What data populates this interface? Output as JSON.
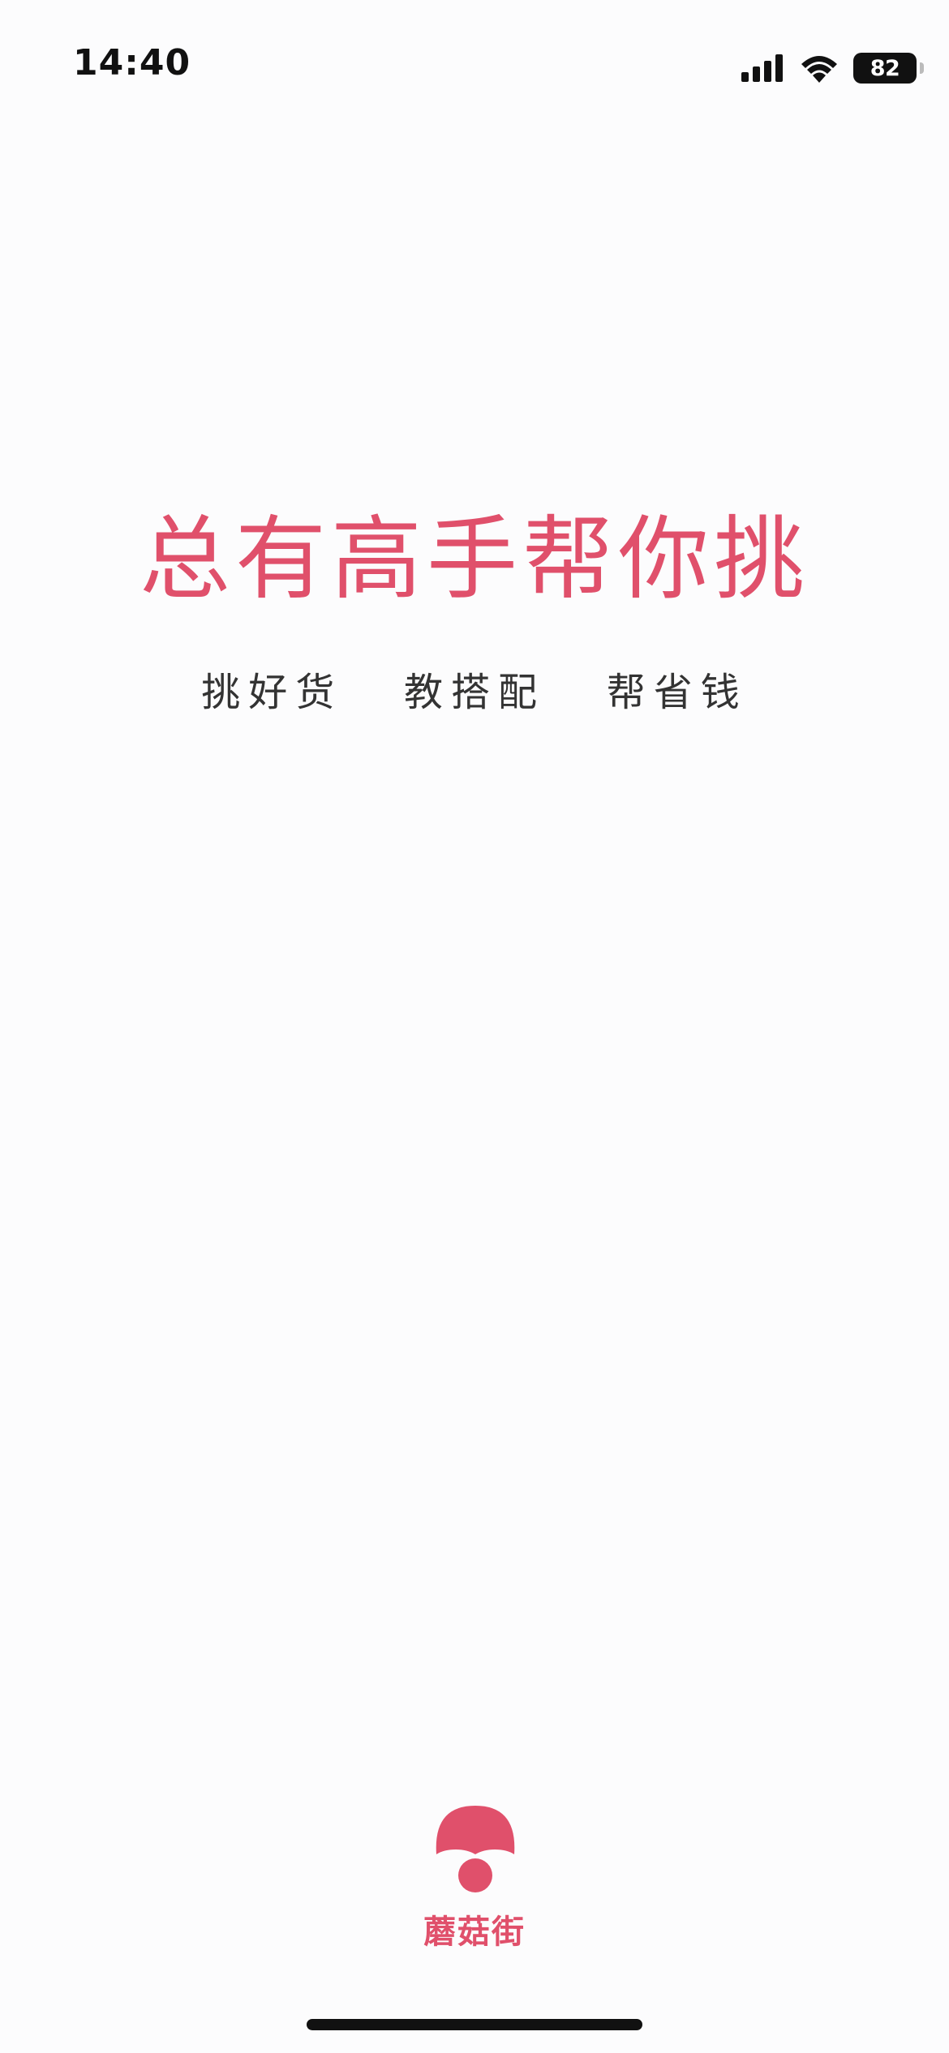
{
  "status_bar": {
    "time": "14:40",
    "battery_level": "82",
    "icons": [
      "cellular-signal-icon",
      "wifi-icon",
      "battery-icon"
    ]
  },
  "splash": {
    "headline": "总有高手帮你挑",
    "tagline": "挑好货   教搭配   帮省钱"
  },
  "brand": {
    "name": "蘑菇街",
    "logo_icon": "mushroom-logo-icon",
    "color": "#e0506b"
  }
}
